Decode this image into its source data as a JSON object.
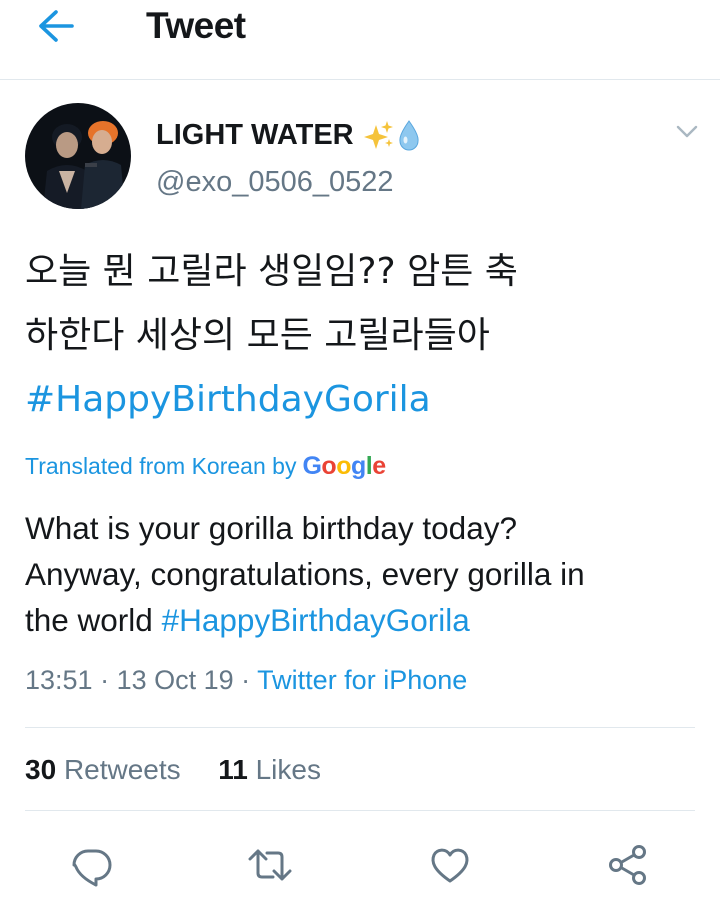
{
  "header": {
    "title": "Tweet"
  },
  "tweet": {
    "name": "LIGHT WATER",
    "handle": "@exo_0506_0522",
    "korean_line1": "오늘 뭔 고릴라 생일임?? 암튼 축",
    "korean_line2": "하한다 세상의 모든 고릴라들아",
    "hashtag": "#HappyBirthdayGorila",
    "translated_label": "Translated from Korean by",
    "translated_service": "Google",
    "translation_line1": "What is your gorilla birthday today?",
    "translation_line2": "Anyway, congratulations, every gorilla in",
    "translation_line3_prefix": "the world ",
    "time": "13:51",
    "date": "13 Oct 19",
    "source": "Twitter for iPhone",
    "separator": " · ",
    "retweets_count": "30",
    "retweets_label": "Retweets",
    "likes_count": "11",
    "likes_label": "Likes"
  },
  "colors": {
    "accent": "#1b95e0",
    "secondary_text": "#657786",
    "primary_text": "#14171a",
    "divider": "#e1e8ed"
  },
  "icons": {
    "back": "arrow-left-icon",
    "menu": "chevron-down-icon",
    "reply": "reply-icon",
    "retweet": "retweet-icon",
    "like": "heart-icon",
    "share": "share-icon",
    "name_emojis": [
      "sparkles-icon",
      "droplet-icon"
    ]
  }
}
